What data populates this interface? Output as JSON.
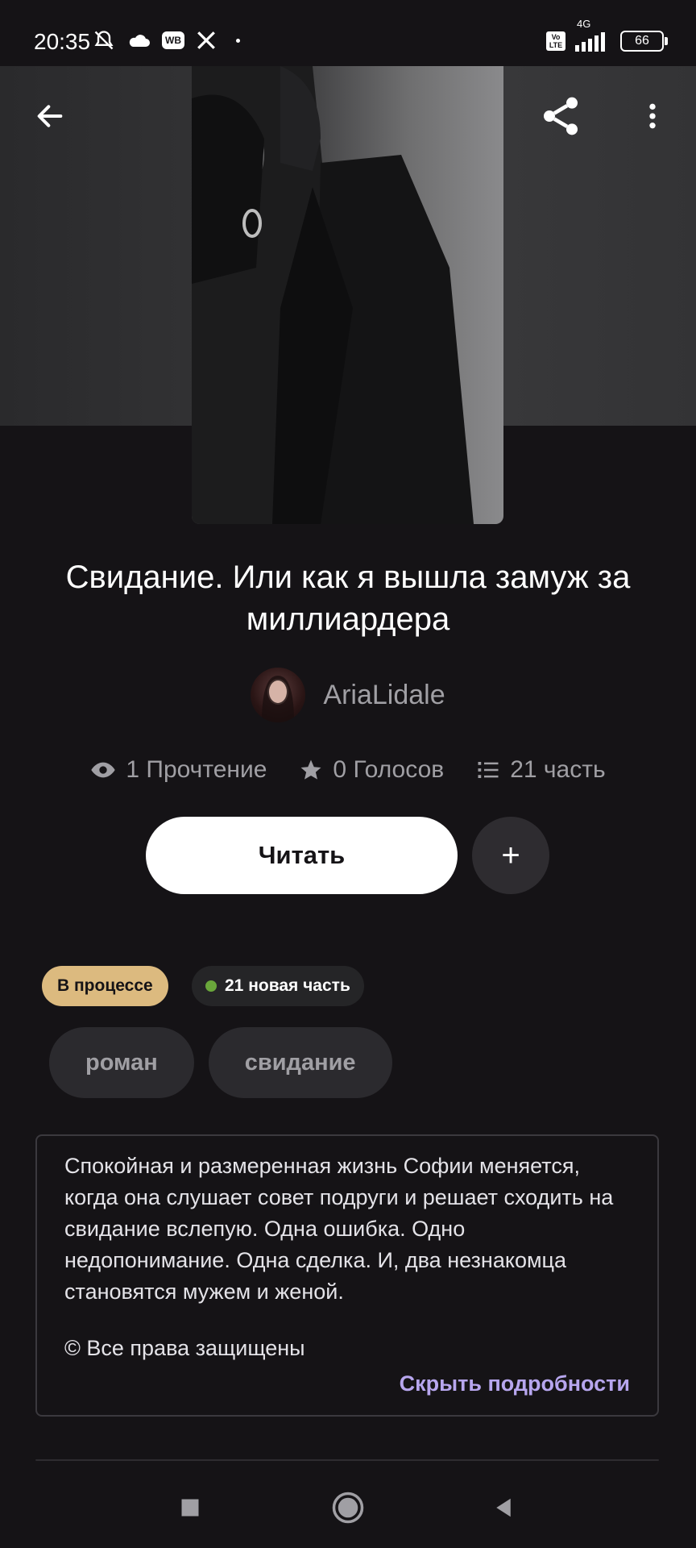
{
  "status_bar": {
    "time": "20:35",
    "battery": "66",
    "network": "4G",
    "volte": "Vo LTE",
    "wb": "WB"
  },
  "header": {
    "back_icon": "arrow-left-icon",
    "share_icon": "share-icon",
    "more_icon": "more-vertical-icon"
  },
  "story": {
    "title": "Свидание. Или как я вышла замуж за миллиардера",
    "author": "AriaLidale",
    "stats": {
      "reads": "1 Прочтение",
      "votes": "0 Голосов",
      "parts": "21 часть"
    },
    "read_button": "Читать",
    "add_button": "+",
    "status_badge": "В процессе",
    "new_parts_badge": "21 новая часть",
    "tags": [
      "роман",
      "свидание"
    ],
    "description": "Спокойная и размеренная жизнь Софии меняется, когда она слушает совет подруги и решает сходить на свидание вслепую. Одна ошибка. Одно недопонимание. Одна сделка. И, два незнакомца становятся мужем и женой.",
    "copyright": "© Все права защищены",
    "hide_details": "Скрыть подробности"
  },
  "colors": {
    "background": "#151316",
    "accent_link": "#b7a6ee",
    "status_badge": "#dcba7f",
    "new_dot": "#6aa73b"
  }
}
